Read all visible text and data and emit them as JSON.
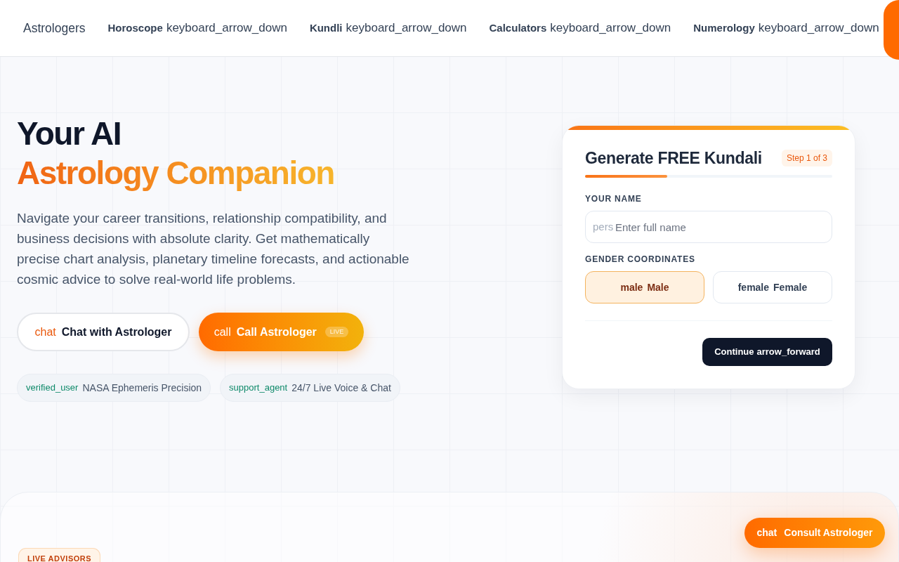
{
  "nav": {
    "items": [
      {
        "label": "Astrologers"
      },
      {
        "label": "Horoscope",
        "icon_text": "keyboard_arrow_down"
      },
      {
        "label": "Kundli",
        "icon_text": "keyboard_arrow_down"
      },
      {
        "label": "Calculators",
        "icon_text": "keyboard_arrow_down"
      },
      {
        "label": "Numerology",
        "icon_text": "keyboard_arrow_down"
      }
    ]
  },
  "hero": {
    "title_line_1": "Your AI",
    "title_line_2": "Astrology Companion",
    "description": "Navigate your career transitions, relationship compatibility, and business decisions with absolute clarity. Get mathematically precise chart analysis, planetary timeline forecasts, and actionable cosmic advice to solve real-world life problems.",
    "buttons": [
      {
        "kind": "outline",
        "icon_text": "chat",
        "label": "Chat with Astrologer"
      },
      {
        "kind": "primary",
        "icon_text": "call",
        "label": "Call Astrologer",
        "badge": "LIVE"
      }
    ],
    "features": [
      {
        "icon_text": "verified_user",
        "label": "NASA Ephemeris Precision"
      },
      {
        "icon_text": "support_agent",
        "label": "24/7 Live Voice & Chat"
      }
    ]
  },
  "kundali_form": {
    "title": "Generate FREE Kundali",
    "step": "Step 1 of 3",
    "progress": {
      "level": 0.333
    },
    "name_field": {
      "label": "YOUR NAME",
      "icon_text": "pers",
      "placeholder": "Enter full name"
    },
    "gender": {
      "label": "GENDER COORDINATES",
      "options": [
        {
          "icon_text": "male",
          "label": "Male",
          "selected": true
        },
        {
          "icon_text": "female",
          "label": "Female",
          "selected": false
        }
      ]
    },
    "continue_button": {
      "label": "Continue",
      "icon_text": "arrow_forward"
    }
  },
  "advisors_section": {
    "badge": "LIVE ADVISORS"
  },
  "floating_button": {
    "icon_text": "chat",
    "label": "Consult Astrologer"
  }
}
